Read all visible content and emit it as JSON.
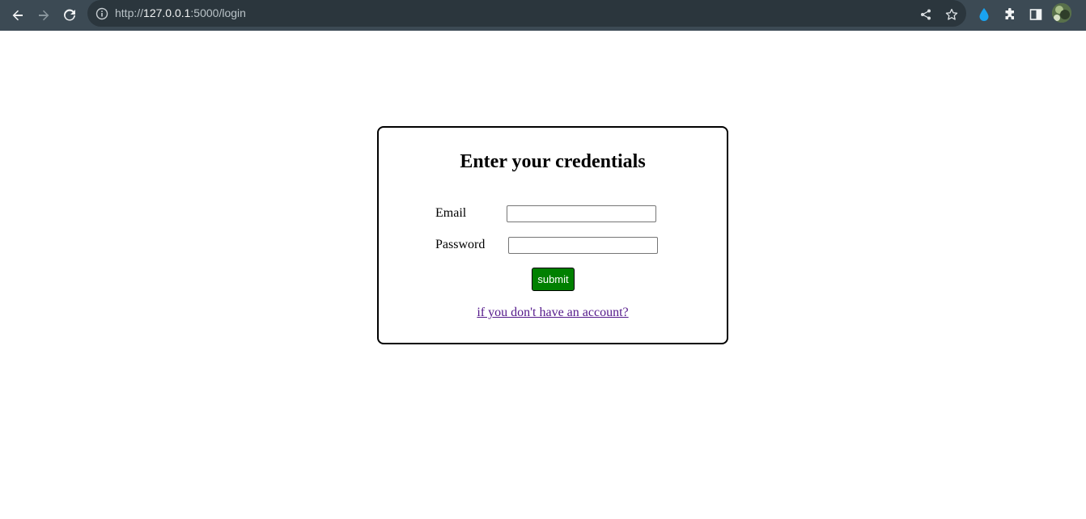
{
  "browser": {
    "url_host": "127.0.0.1",
    "url_scheme": "http://",
    "url_path": ":5000/login",
    "icons": {
      "back": "arrow-left-icon",
      "forward": "arrow-right-icon",
      "reload": "reload-icon",
      "site_info": "info-icon",
      "share": "share-icon",
      "bookmark": "star-icon",
      "extension_drop": "drop-icon",
      "extensions": "puzzle-icon",
      "side_panel": "side-panel-icon"
    },
    "colors": {
      "toolbar": "#3c4a54",
      "omnibox": "#2b363d"
    }
  },
  "login": {
    "title": "Enter your credentials",
    "email_label": "Email",
    "email_value": "",
    "password_label": "Password",
    "password_value": "",
    "submit_label": "submit",
    "register_link": "if you don't have an account?",
    "colors": {
      "submit_bg": "#008000",
      "link": "#551a8b"
    }
  }
}
